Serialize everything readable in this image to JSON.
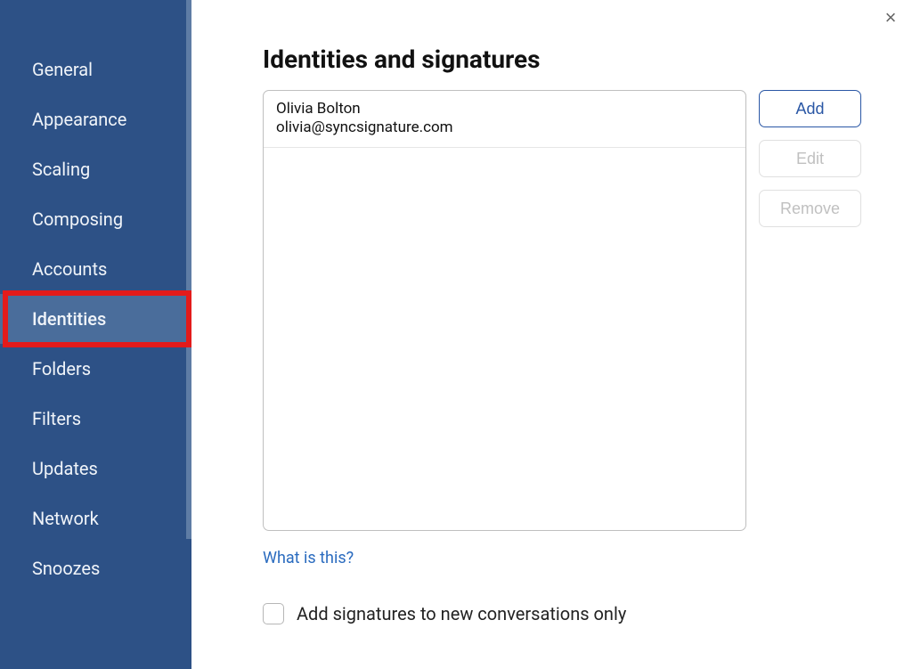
{
  "sidebar": {
    "items": [
      {
        "label": "General",
        "key": "general"
      },
      {
        "label": "Appearance",
        "key": "appearance"
      },
      {
        "label": "Scaling",
        "key": "scaling"
      },
      {
        "label": "Composing",
        "key": "composing"
      },
      {
        "label": "Accounts",
        "key": "accounts"
      },
      {
        "label": "Identities",
        "key": "identities"
      },
      {
        "label": "Folders",
        "key": "folders"
      },
      {
        "label": "Filters",
        "key": "filters"
      },
      {
        "label": "Updates",
        "key": "updates"
      },
      {
        "label": "Network",
        "key": "network"
      },
      {
        "label": "Snoozes",
        "key": "snoozes"
      }
    ],
    "active_index": 5,
    "highlight_index": 5
  },
  "main": {
    "title": "Identities and signatures",
    "identities": [
      {
        "name": "Olivia Bolton",
        "email": "olivia@syncsignature.com"
      }
    ],
    "buttons": {
      "add": "Add",
      "edit": "Edit",
      "remove": "Remove"
    },
    "help_link": "What is this?",
    "checkbox_label": "Add signatures to new conversations only",
    "checkbox_checked": false
  },
  "close_icon": "×"
}
